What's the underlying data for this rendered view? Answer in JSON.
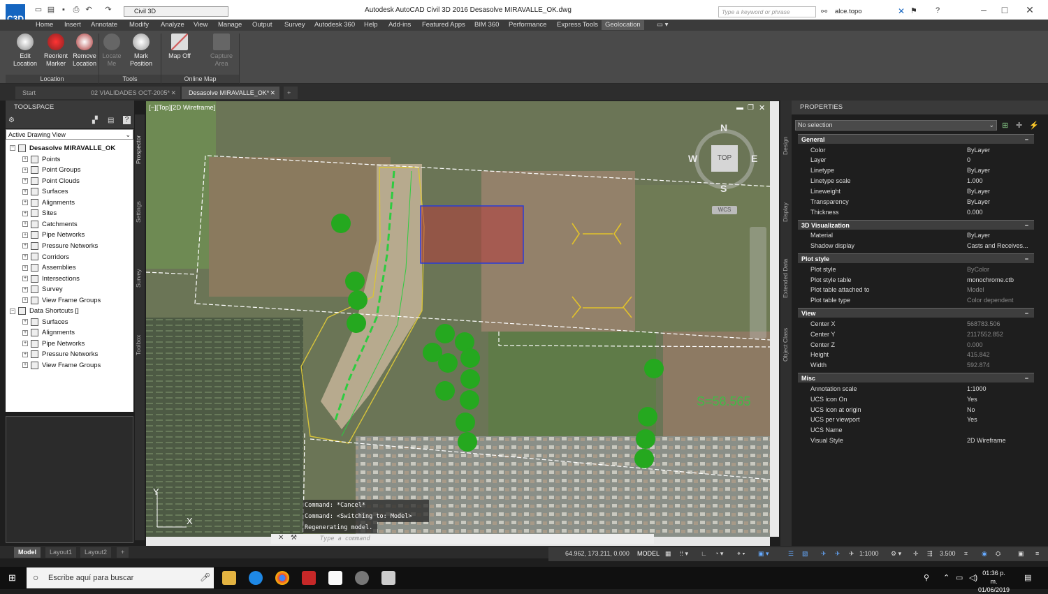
{
  "app": {
    "window_title": "Autodesk AutoCAD Civil 3D 2016    Desasolve MIRAVALLE_OK.dwg",
    "app_icon_label": "C3D",
    "workspace": "Civil 3D",
    "search_placeholder": "Type a keyword or phrase",
    "user": "alce.topo"
  },
  "menu": [
    "Home",
    "Insert",
    "Annotate",
    "Modify",
    "Analyze",
    "View",
    "Manage",
    "Output",
    "Survey",
    "Autodesk 360",
    "Help",
    "Add-ins",
    "Featured Apps",
    "BIM 360",
    "Performance",
    "Express Tools",
    "Geolocation"
  ],
  "ribbon": {
    "buttons": {
      "edit_location": "Edit Location",
      "reorient_marker": "Reorient Marker",
      "remove_location": "Remove Location",
      "locate_me": "Locate Me",
      "mark_position": "Mark Position",
      "map_off": "Map Off",
      "capture_area": "Capture Area"
    },
    "panels": {
      "location": "Location",
      "tools": "Tools",
      "online_map": "Online Map"
    }
  },
  "doc_tabs": [
    "Start",
    "02 VIALIDADES OCT-2005*",
    "Desasolve MIRAVALLE_OK*"
  ],
  "toolspace": {
    "title": "TOOLSPACE",
    "view": "Active Drawing View",
    "tree": [
      {
        "label": "Desasolve MIRAVALLE_OK",
        "level": 0,
        "bold": true
      },
      {
        "label": "Points",
        "level": 1
      },
      {
        "label": "Point Groups",
        "level": 1
      },
      {
        "label": "Point Clouds",
        "level": 1
      },
      {
        "label": "Surfaces",
        "level": 1
      },
      {
        "label": "Alignments",
        "level": 1
      },
      {
        "label": "Sites",
        "level": 1
      },
      {
        "label": "Catchments",
        "level": 1
      },
      {
        "label": "Pipe Networks",
        "level": 1
      },
      {
        "label": "Pressure Networks",
        "level": 1
      },
      {
        "label": "Corridors",
        "level": 1
      },
      {
        "label": "Assemblies",
        "level": 1
      },
      {
        "label": "Intersections",
        "level": 1
      },
      {
        "label": "Survey",
        "level": 1
      },
      {
        "label": "View Frame Groups",
        "level": 1
      },
      {
        "label": "Data Shortcuts []",
        "level": 0
      },
      {
        "label": "Surfaces",
        "level": 1
      },
      {
        "label": "Alignments",
        "level": 1
      },
      {
        "label": "Pipe Networks",
        "level": 1
      },
      {
        "label": "Pressure Networks",
        "level": 1
      },
      {
        "label": "View Frame Groups",
        "level": 1
      }
    ],
    "side_tabs": [
      "Prospector",
      "Settings",
      "Survey",
      "Toolbox"
    ]
  },
  "viewport": {
    "label": "[−][Top][2D Wireframe]",
    "viewcube": {
      "n": "N",
      "s": "S",
      "e": "E",
      "w": "W",
      "top": "TOP",
      "wcs": "WCS"
    },
    "slope_text": "S=58.565",
    "ucs_x": "X",
    "ucs_y": "Y",
    "command_history": [
      "Command: *Cancel*",
      "Command:   <Switching to: Model>",
      "Regenerating model."
    ],
    "command_placeholder": "Type a command"
  },
  "properties": {
    "title": "PROPERTIES",
    "selection": "No selection",
    "side_tabs": [
      "Design",
      "Display",
      "Extended Data",
      "Object Class"
    ],
    "sections": [
      {
        "name": "General",
        "rows": [
          [
            "Color",
            "ByLayer"
          ],
          [
            "Layer",
            "0"
          ],
          [
            "Linetype",
            "ByLayer"
          ],
          [
            "Linetype scale",
            "1.000"
          ],
          [
            "Lineweight",
            "ByLayer"
          ],
          [
            "Transparency",
            "ByLayer"
          ],
          [
            "Thickness",
            "0.000"
          ]
        ]
      },
      {
        "name": "3D Visualization",
        "rows": [
          [
            "Material",
            "ByLayer"
          ],
          [
            "Shadow display",
            "Casts and Receives..."
          ]
        ]
      },
      {
        "name": "Plot style",
        "rows": [
          [
            "Plot style",
            "ByColor"
          ],
          [
            "Plot style table",
            "monochrome.ctb"
          ],
          [
            "Plot table attached to",
            "Model"
          ],
          [
            "Plot table type",
            "Color dependent"
          ]
        ]
      },
      {
        "name": "View",
        "rows": [
          [
            "Center X",
            "568783.506"
          ],
          [
            "Center Y",
            "2117552.852"
          ],
          [
            "Center Z",
            "0.000"
          ],
          [
            "Height",
            "415.842"
          ],
          [
            "Width",
            "592.874"
          ]
        ]
      },
      {
        "name": "Misc",
        "rows": [
          [
            "Annotation scale",
            "1:1000"
          ],
          [
            "UCS icon On",
            "Yes"
          ],
          [
            "UCS icon at origin",
            "No"
          ],
          [
            "UCS per viewport",
            "Yes"
          ],
          [
            "UCS Name",
            ""
          ],
          [
            "Visual Style",
            "2D Wireframe"
          ]
        ]
      }
    ]
  },
  "layout_tabs": [
    "Model",
    "Layout1",
    "Layout2"
  ],
  "status": {
    "coords": "64.962, 173.211, 0.000",
    "space": "MODEL",
    "scale": "1:1000",
    "value": "3.500"
  },
  "taskbar": {
    "search": "Escribe aquí para buscar",
    "time": "01:36 p. m.",
    "date": "01/06/2019"
  }
}
